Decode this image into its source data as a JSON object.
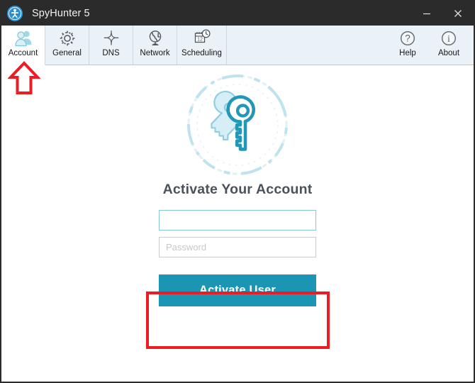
{
  "window": {
    "title": "SpyHunter 5",
    "logo_icon": "spyhunter-logo-icon",
    "controls": [
      {
        "name": "minimize-button",
        "icon": "minimize-icon",
        "label": "—"
      },
      {
        "name": "close-button",
        "icon": "close-icon",
        "label": "✕"
      }
    ]
  },
  "toolbar": {
    "tabs": [
      {
        "label": "Account",
        "icon": "users-icon",
        "active": true
      },
      {
        "label": "General",
        "icon": "gear-icon",
        "active": false
      },
      {
        "label": "DNS",
        "icon": "compass-icon",
        "active": false
      },
      {
        "label": "Network",
        "icon": "globe-icon",
        "active": false
      },
      {
        "label": "Scheduling",
        "icon": "calendar-clock-icon",
        "active": false
      }
    ],
    "right_tabs": [
      {
        "label": "Help",
        "icon": "question-circle-icon"
      },
      {
        "label": "About",
        "icon": "info-circle-icon"
      }
    ]
  },
  "main": {
    "badge_icon": "keys-icon",
    "heading": "Activate Your Account",
    "username": {
      "value": "",
      "placeholder": ""
    },
    "password": {
      "value": "",
      "placeholder": "Password"
    },
    "activate_button": "Activate User"
  },
  "annotations": {
    "highlight_rect": "activate-user-button-highlight",
    "arrow": "account-tab-arrow",
    "color": "#ee1b24"
  },
  "colors": {
    "titlebar": "#2b2b2b",
    "toolbar": "#eaf1f7",
    "accent_teal": "#1a96b4",
    "badge_blue": "#2298b8",
    "heading": "#4a525c",
    "annotation_red": "#ee1b24"
  }
}
